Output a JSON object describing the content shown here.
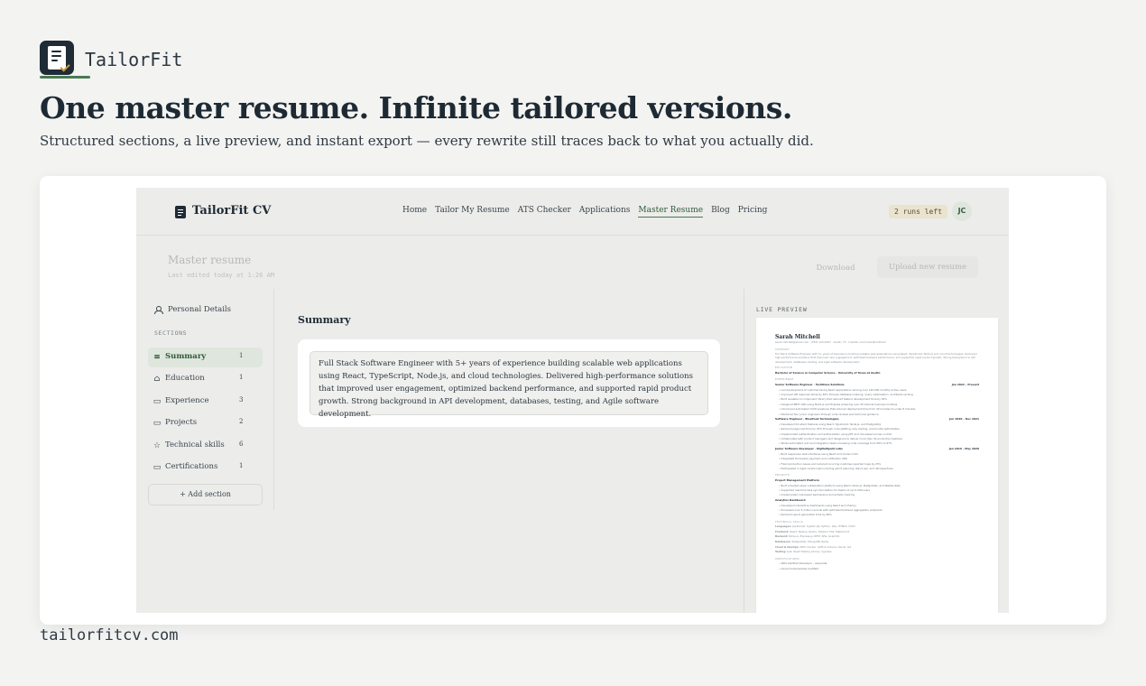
{
  "brand": {
    "name": "TailorFit"
  },
  "hero": {
    "title": "One master resume. Infinite tailored versions.",
    "subtitle": "Structured sections, a live preview, and instant export — every rewrite still traces back to what you actually did."
  },
  "footer": {
    "url": "tailorfitcv.com"
  },
  "app": {
    "name": "TailorFit CV",
    "nav": [
      "Home",
      "Tailor My Resume",
      "ATS Checker",
      "Applications",
      "Master Resume",
      "Blog",
      "Pricing"
    ],
    "nav_active": "Master Resume",
    "runs_left": "2 runs left",
    "avatar": "JC",
    "page_title": "Master resume",
    "last_edited": "Last edited today at 1:26 AM",
    "download_label": "Download",
    "upload_label": "Upload new resume"
  },
  "sidebar": {
    "personal_details": "Personal Details",
    "sections_label": "SECTIONS",
    "items": [
      {
        "label": "Summary",
        "count": "1",
        "icon": "lines-icon",
        "active": true
      },
      {
        "label": "Education",
        "count": "1",
        "icon": "graduation-cap-icon"
      },
      {
        "label": "Experience",
        "count": "3",
        "icon": "briefcase-icon"
      },
      {
        "label": "Projects",
        "count": "2",
        "icon": "folder-icon"
      },
      {
        "label": "Technical skills",
        "count": "6",
        "icon": "star-icon"
      },
      {
        "label": "Certifications",
        "count": "1",
        "icon": "certificate-icon"
      }
    ],
    "add_section": "+ Add section"
  },
  "editor": {
    "heading": "Summary",
    "text": "Full Stack Software Engineer with 5+ years of experience building scalable web applications using React, TypeScript, Node.js, and cloud technologies. Delivered high-performance solutions that improved user engagement, optimized backend performance, and supported rapid product growth. Strong background in API development, databases, testing, and Agile software development."
  },
  "preview": {
    "label": "LIVE PREVIEW",
    "name": "Sarah Mitchell",
    "contact": "sarah.mitchell@email.com · (555) 123-4567 · Austin, TX · linkedin.com/in/sarahmitchell",
    "summary_head": "SUMMARY",
    "summary": "Full Stack Software Engineer with 5+ years of experience building scalable web applications using React, TypeScript, Node.js and cloud technologies. Delivered high-performance solutions that improved user engagement, optimized backend performance, and supported rapid product growth. Strong background in API development, databases, testing, and Agile software development.",
    "education_head": "EDUCATION",
    "education": "Bachelor of Science in Computer Science · University of Texas at Austin",
    "experience_head": "EXPERIENCE",
    "jobs": [
      {
        "title": "Senior Software Engineer · TechNova Solutions",
        "dates": "Jan 2022 – Present",
        "bullets": [
          "Led development of customer-facing React applications serving over 120,000 monthly active users",
          "Improved API response times by 40% through database indexing, query optimization, and Redis caching",
          "Built reusable UI component library that reduced feature development time by 30%",
          "Designed REST APIs using Node.js and Express powering over 20 internal business modules",
          "Introduced automated CI/CD pipelines that reduced deployment time from 30 minutes to under 8 minutes",
          "Mentored four junior engineers through code reviews and technical guidance"
        ]
      },
      {
        "title": "Software Engineer · BluePeak Technologies",
        "dates": "Jun 2020 – Dec 2021",
        "bullets": [
          "Developed full-stack features using React, TypeScript, Node.js, and PostgreSQL",
          "Reduced page load time by 45% through code splitting, lazy loading, and bundle optimization",
          "Implemented authentication and authorization using JWT and role-based access control",
          "Collaborated with product managers and designers to deliver more than 40 production features",
          "Wrote automated unit and integration tests increasing code coverage from 58% to 87%"
        ]
      },
      {
        "title": "Junior Software Developer · DigitalSpark Labs",
        "dates": "Jan 2019 – May 2020",
        "bullets": [
          "Built responsive web interfaces using React and modern CSS",
          "Integrated third-party payment and notification APIs",
          "Fixed production issues and reduced recurring customer-reported bugs by 25%",
          "Participated in Agile ceremonies including sprint planning, stand-ups, and retrospectives"
        ]
      }
    ],
    "projects_head": "PROJECTS",
    "projects": [
      {
        "title": "Project Management Platform",
        "bullets": [
          "Built a Kanban-style collaboration platform using React, Node.js, PostgreSQL, and WebSockets",
          "Supported real-time task synchronization for teams of up to 500 users",
          "Implemented role-based permissions and activity tracking"
        ]
      },
      {
        "title": "Analytics Dashboard",
        "bullets": [
          "Developed interactive dashboards using React and Chart.js",
          "Processed over 5 million records with optimized backend aggregation endpoints",
          "Reduced report generation time by 60%"
        ]
      }
    ],
    "skills_head": "TECHNICAL SKILLS",
    "skills": [
      {
        "k": "Languages:",
        "v": "JavaScript, TypeScript, Python, SQL, HTML5, CSS3"
      },
      {
        "k": "Frontend:",
        "v": "React, Next.js, Redux, Tailwind CSS, Material UI"
      },
      {
        "k": "Backend:",
        "v": "Node.js, Express.js, REST APIs, GraphQL"
      },
      {
        "k": "Databases:",
        "v": "PostgreSQL, MongoDB, Redis"
      },
      {
        "k": "Cloud & DevOps:",
        "v": "AWS, Docker, GitHub Actions, Vercel, Git"
      },
      {
        "k": "Testing:",
        "v": "Jest, React Testing Library, Cypress"
      }
    ],
    "certs_head": "CERTIFICATIONS",
    "certs": [
      "AWS Certified Developer – Associate",
      "Azure Fundamentals Certified"
    ]
  }
}
